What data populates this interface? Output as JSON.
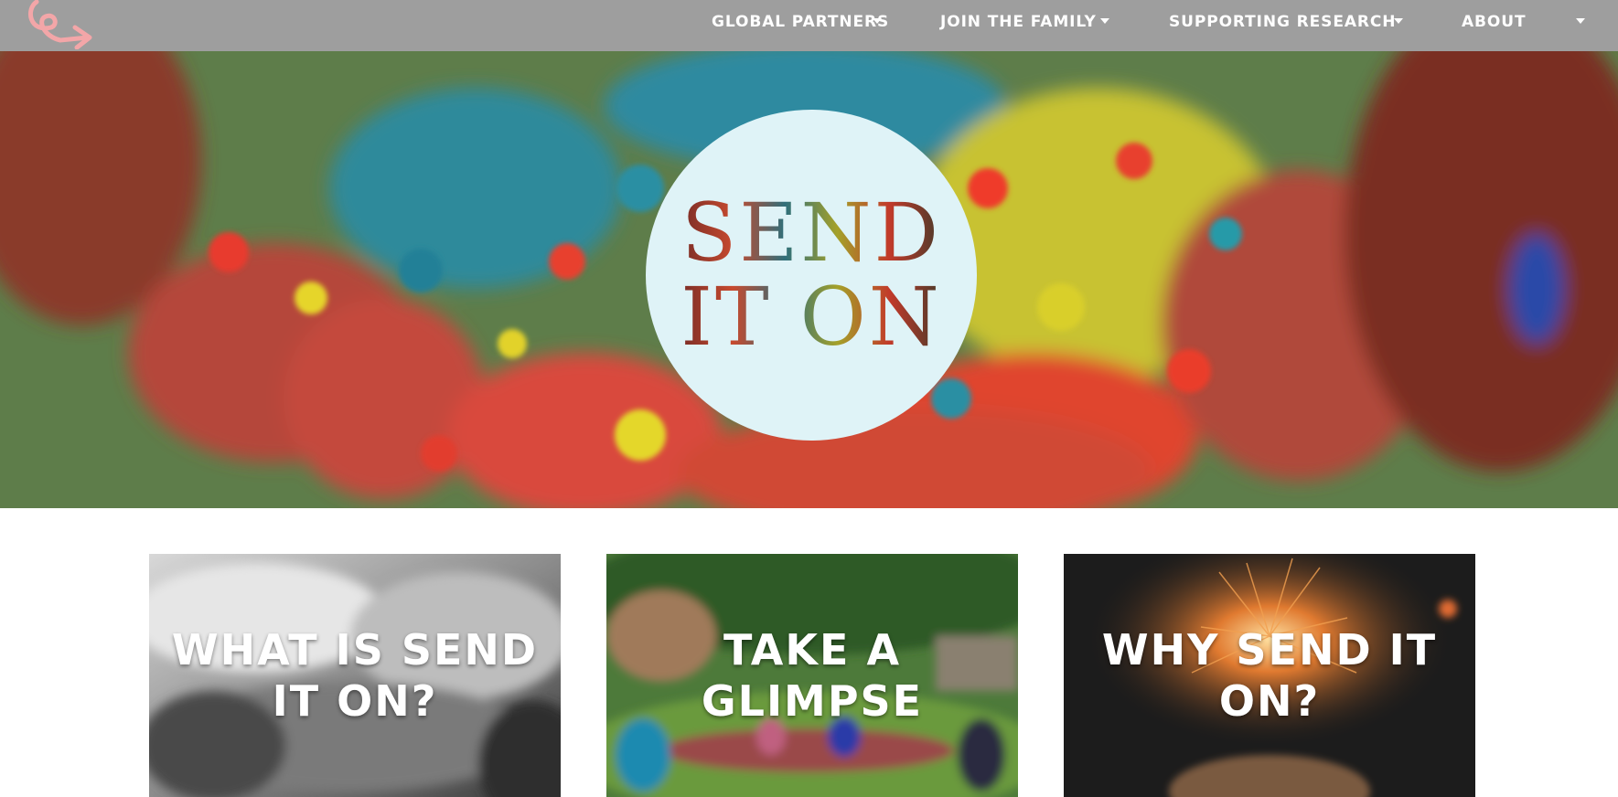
{
  "nav": {
    "items": [
      {
        "label": "GLOBAL PARTNERS"
      },
      {
        "label": "JOIN THE FAMILY"
      },
      {
        "label": "SUPPORTING RESEARCH"
      },
      {
        "label": "ABOUT"
      }
    ]
  },
  "hero": {
    "logo_line1": "SEND",
    "logo_line2": "IT ON"
  },
  "cards": [
    {
      "title": "WHAT IS SEND IT ON?"
    },
    {
      "title": "TAKE A GLIMPSE"
    },
    {
      "title": "WHY SEND IT ON?"
    }
  ],
  "colors": {
    "nav_bg": "#9e9e9e",
    "logo_pink": "#f3a6a8",
    "logo_circle": "#dff3f7"
  },
  "icons": {
    "brand_logo": "arrow-loop-icon",
    "dropdown": "caret-down-icon"
  }
}
